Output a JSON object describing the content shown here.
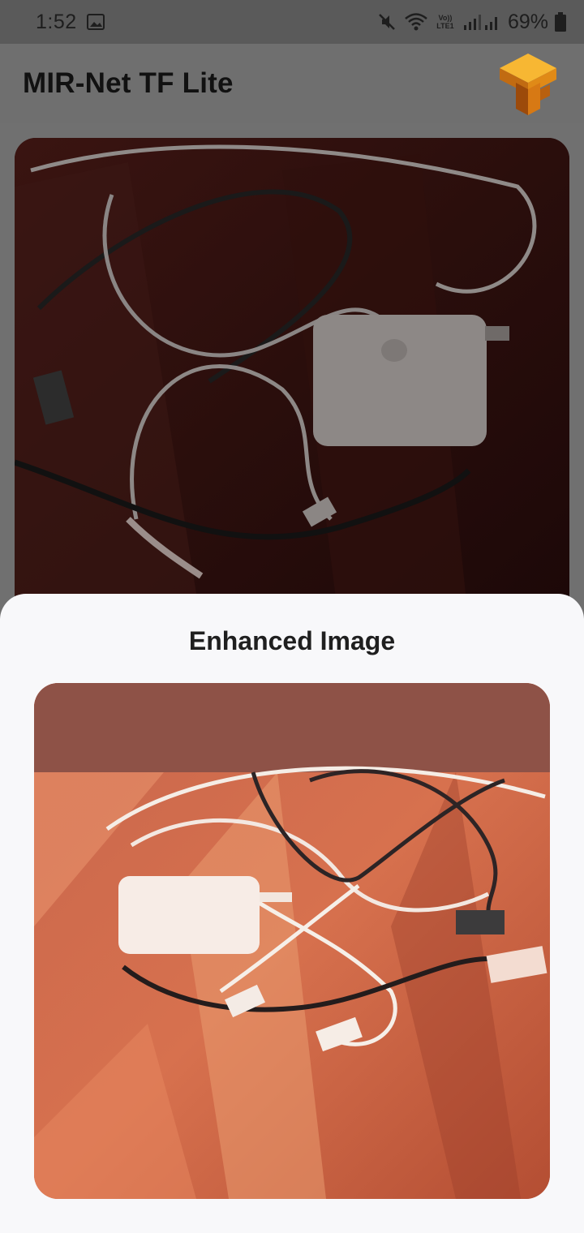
{
  "status_bar": {
    "time": "1:52",
    "battery_percent": "69%",
    "network_label": "Vo)) LTE1",
    "icons": [
      "gallery-icon",
      "mute-icon",
      "wifi-icon",
      "signal-icon",
      "battery-icon"
    ]
  },
  "app_bar": {
    "title": "MIR-Net TF Lite",
    "logo": "tensorflow-logo-icon"
  },
  "main": {
    "original_image_alt": "original low-light photo"
  },
  "bottom_sheet": {
    "title": "Enhanced Image"
  },
  "colors": {
    "status_bar_bg": "#5a5a5a",
    "app_bar_bg": "#6f6f6f",
    "sheet_bg": "#f8f8fa",
    "logo_orange": "#f19a1b"
  }
}
